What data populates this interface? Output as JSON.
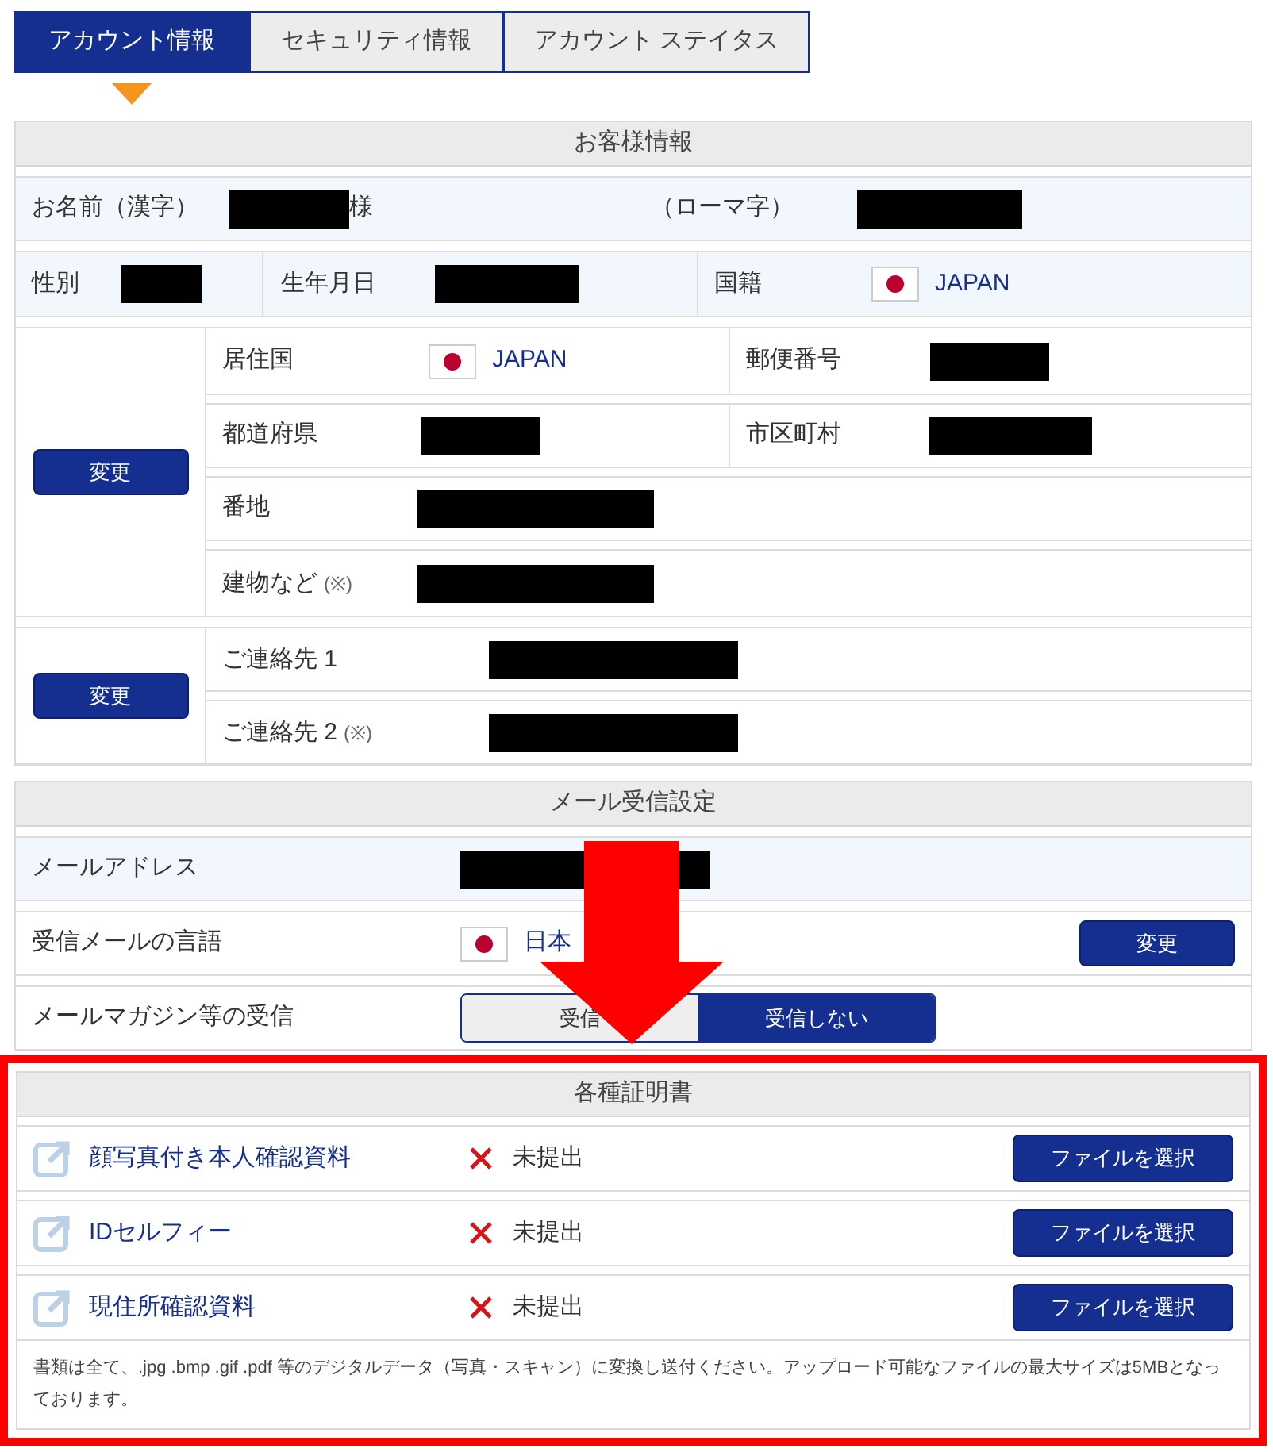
{
  "tabs": [
    {
      "label": "アカウント情報",
      "selected": true
    },
    {
      "label": "セキュリティ情報",
      "selected": false
    },
    {
      "label": "アカウント ステイタス",
      "selected": false
    }
  ],
  "customer": {
    "title": "お客様情報",
    "name_label": "お名前（漢字）",
    "name_suffix": "様",
    "roman_label": "（ローマ字）",
    "gender_label": "性別",
    "birth_label": "生年月日",
    "nationality_label": "国籍",
    "nationality_value": "JAPAN",
    "address": {
      "button": "変更",
      "country_label": "居住国",
      "country_value": "JAPAN",
      "postal_label": "郵便番号",
      "prefecture_label": "都道府県",
      "city_label": "市区町村",
      "street_label": "番地",
      "building_label": "建物など",
      "building_note": "(※)"
    },
    "contact": {
      "button": "変更",
      "rows": [
        {
          "label": "ご連絡先 1"
        },
        {
          "label": "ご連絡先 2",
          "note": "(※)"
        }
      ]
    }
  },
  "mail": {
    "title": "メール受信設定",
    "address_label": "メールアドレス",
    "language_label": "受信メールの言語",
    "language_value": "日本",
    "language_button": "変更",
    "magazine_label": "メールマガジン等の受信",
    "options": [
      {
        "label": "受信",
        "selected": false
      },
      {
        "label": "受信しない",
        "selected": true
      }
    ]
  },
  "certificates": {
    "title": "各種証明書",
    "items": [
      {
        "label": "顔写真付き本人確認資料",
        "status": "未提出",
        "button": "ファイルを選択"
      },
      {
        "label": "IDセルフィー",
        "status": "未提出",
        "button": "ファイルを選択"
      },
      {
        "label": "現住所確認資料",
        "status": "未提出",
        "button": "ファイルを選択"
      }
    ],
    "note": "書類は全て、.jpg .bmp .gif .pdf 等のデジタルデータ（写真・スキャン）に変換し送付ください。アップロード可能なファイルの最大サイズは5MBとなっております。"
  }
}
